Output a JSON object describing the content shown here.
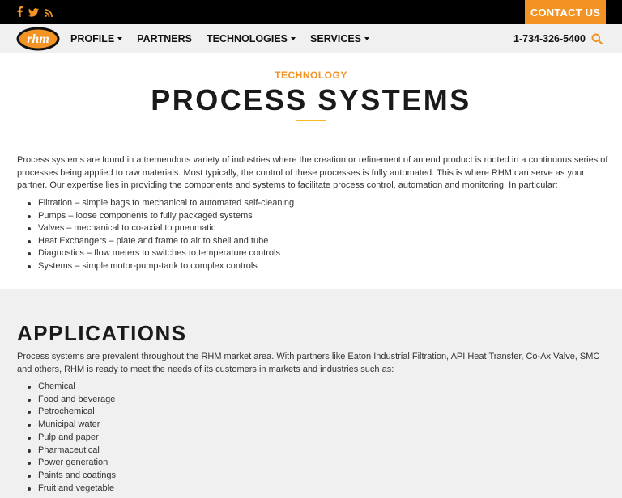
{
  "topbar": {
    "social_icons": [
      "facebook-icon",
      "twitter-icon",
      "rss-icon"
    ],
    "contact_label": "CONTACT US"
  },
  "nav": {
    "logo_text": "rhm",
    "items": [
      {
        "label": "PROFILE",
        "dropdown": true
      },
      {
        "label": "PARTNERS",
        "dropdown": false
      },
      {
        "label": "TECHNOLOGIES",
        "dropdown": true
      },
      {
        "label": "SERVICES",
        "dropdown": true
      }
    ],
    "phone": "1-734-326-5400"
  },
  "hero": {
    "eyebrow": "TECHNOLOGY",
    "title": "PROCESS SYSTEMS"
  },
  "intro": {
    "paragraph": "Process systems are found in a tremendous variety of industries where the creation or refinement of an end product is rooted in a continuous series of processes being applied to raw materials.  Most typically, the control of these processes is fully automated.  This is where RHM can serve as your partner.  Our expertise lies in providing the components and systems to facilitate process control, automation and monitoring.  In particular:",
    "items": [
      "Filtration  – simple bags to mechanical to automated self-cleaning",
      "Pumps – loose components to fully packaged systems",
      "Valves –  mechanical to co-axial to pneumatic",
      "Heat Exchangers – plate and frame to air to shell and tube",
      "Diagnostics – flow meters to switches to temperature controls",
      "Systems – simple motor-pump-tank to complex controls"
    ]
  },
  "applications": {
    "title": "APPLICATIONS",
    "paragraph": "Process systems are prevalent throughout the RHM market area.  With partners like Eaton Industrial Filtration, API Heat Transfer, Co-Ax Valve, SMC and others, RHM is ready to meet the needs of its customers in markets and industries such as:",
    "items": [
      "Chemical",
      "Food and beverage",
      "Petrochemical",
      "Municipal water",
      "Pulp and paper",
      "Pharmaceutical",
      "Power generation",
      "Paints and coatings",
      "Fruit and vegetable"
    ]
  },
  "colors": {
    "accent": "#f39323",
    "rule": "#f6b820",
    "topbar": "#000000",
    "navbar": "#f0f0f0"
  }
}
